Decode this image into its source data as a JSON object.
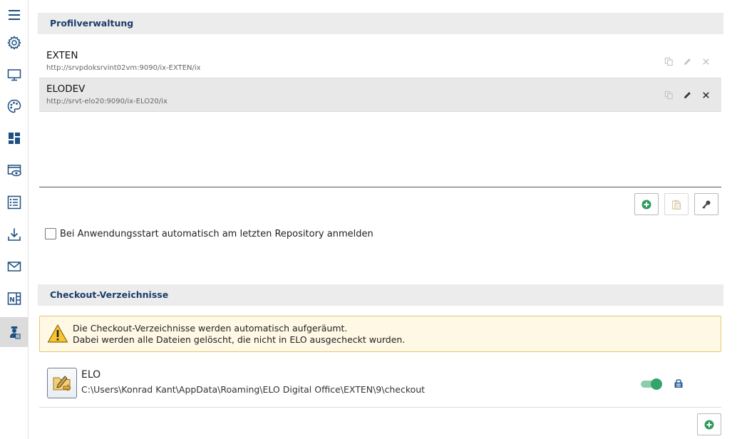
{
  "sidebar": {
    "items": [
      {
        "icon": "hamburger-menu-icon"
      },
      {
        "icon": "gear-icon"
      },
      {
        "icon": "monitor-icon"
      },
      {
        "icon": "palette-icon"
      },
      {
        "icon": "dashboard-icon"
      },
      {
        "icon": "preview-eye-icon"
      },
      {
        "icon": "list-icon"
      },
      {
        "icon": "download-icon"
      },
      {
        "icon": "mail-icon"
      },
      {
        "icon": "onenote-icon"
      },
      {
        "icon": "user-badge-icon",
        "active": true
      }
    ]
  },
  "profile_section": {
    "title": "Profilverwaltung",
    "profiles": [
      {
        "name": "EXTEN",
        "url": "http://srvpdoksrvint02vm:9090/ix-EXTEN/ix"
      },
      {
        "name": "ELODEV",
        "url": "http://srvt-elo20:9090/ix-ELO20/ix"
      }
    ],
    "auto_login_label": "Bei Anwendungsstart automatisch am letzten Repository anmelden"
  },
  "checkout_section": {
    "title": "Checkout-Verzeichnisse",
    "warning_line1": "Die Checkout-Verzeichnisse werden automatisch aufgeräumt.",
    "warning_line2": "Dabei werden alle Dateien gelöscht, die nicht in ELO ausgecheckt wurden.",
    "entry": {
      "name": "ELO",
      "path": "C:\\Users\\Konrad Kant\\AppData\\Roaming\\ELO Digital Office\\EXTEN\\9\\checkout"
    }
  },
  "colors": {
    "header_text": "#1c3d6b",
    "accent_green": "#34a46b",
    "warning_bg": "#fef8e5"
  }
}
